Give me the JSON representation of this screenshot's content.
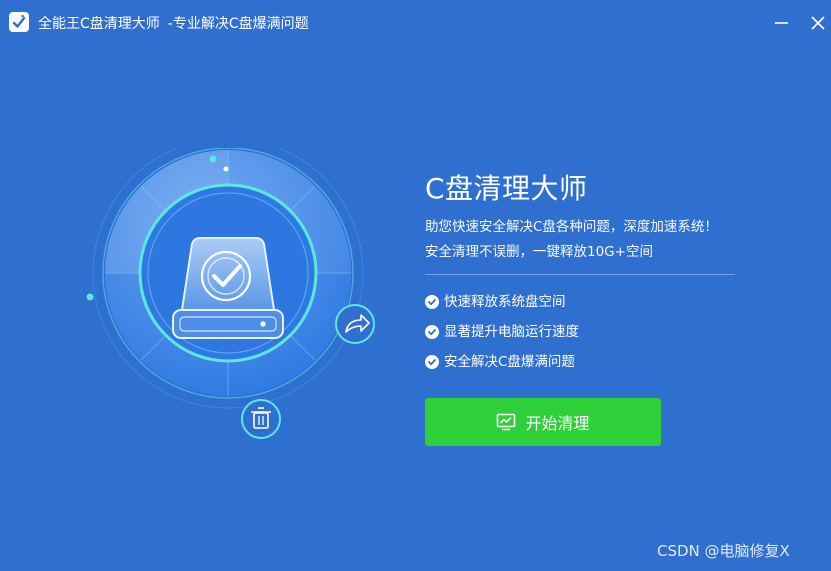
{
  "window": {
    "title": "全能王C盘清理大师",
    "subtitle": "-专业解决C盘爆满问题",
    "minimize_icon": "minimize-icon",
    "close_icon": "close-icon"
  },
  "hero": {
    "title": "C盘清理大师",
    "description_line1": "助您快速安全解决C盘各种问题，深度加速系统！",
    "description_line2": "安全清理不误删，一键释放10G+空间"
  },
  "features": [
    {
      "label": "快速释放系统盘空间",
      "icon": "check-circle-icon"
    },
    {
      "label": "显著提升电脑运行速度",
      "icon": "check-circle-icon"
    },
    {
      "label": "安全解决C盘爆满问题",
      "icon": "check-circle-icon"
    }
  ],
  "start_button": {
    "label": "开始清理",
    "icon": "monitor-chart-icon"
  },
  "illustration": {
    "disk_icon": "hard-drive-check-icon",
    "share_icon": "share-arrow-icon",
    "trash_icon": "trash-icon"
  },
  "watermark": "CSDN @电脑修复X",
  "colors": {
    "background": "#2f6fd0",
    "button": "#2fcf3a",
    "ring_accent": "#5ee6e0"
  }
}
